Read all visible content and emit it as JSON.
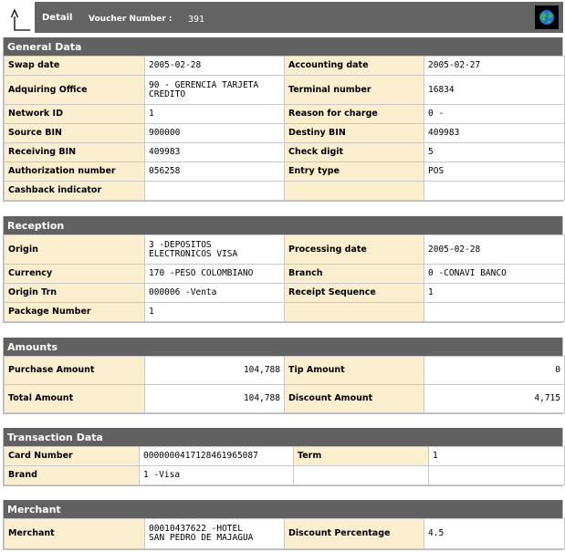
{
  "header": {
    "title": "Detail",
    "voucher_label": "Voucher Number :",
    "voucher_number": "391",
    "back_icon": "corner-up-left-arrow-icon",
    "globe_icon": "globe-icon"
  },
  "general": {
    "title": "General Data",
    "swap_date_label": "Swap date",
    "swap_date": "2005-02-28",
    "accounting_date_label": "Accounting date",
    "accounting_date": "2005-02-27",
    "acquiring_office_label": "Adquiring Office",
    "acquiring_office_1": "90 - GERENCIA TARJETA",
    "acquiring_office_2": "CREDITO",
    "terminal_number_label": "Terminal number",
    "terminal_number": "16834",
    "network_id_label": "Network ID",
    "network_id": "1",
    "reason_label": "Reason for charge",
    "reason": "0 -",
    "source_bin_label": "Source BIN",
    "source_bin": "900000",
    "destiny_bin_label": "Destiny BIN",
    "destiny_bin": "409983",
    "receiving_bin_label": "Receiving BIN",
    "receiving_bin": "409983",
    "check_digit_label": "Check digit",
    "check_digit": "5",
    "authorization_label": "Authorization number",
    "authorization": "056258",
    "entry_type_label": "Entry type",
    "entry_type": "POS",
    "cashback_label": "Cashback indicator",
    "cashback": ""
  },
  "reception": {
    "title": "Reception",
    "origin_label": "Origin",
    "origin_1": "3 -DEPOSITOS",
    "origin_2": "ELECTRONICOS VISA",
    "processing_date_label": "Processing date",
    "processing_date": "2005-02-28",
    "currency_label": "Currency",
    "currency": "170 -PESO COLOMBIANO",
    "branch_label": "Branch",
    "branch": "0 -CONAVI BANCO",
    "origin_trn_label": "Origin Trn",
    "origin_trn": "000006 -Venta",
    "receipt_sequence_label": "Receipt Sequence",
    "receipt_sequence": "1",
    "package_number_label": "Package Number",
    "package_number": "1"
  },
  "amounts": {
    "title": "Amounts",
    "purchase_label": "Purchase Amount",
    "purchase": "104,788",
    "tip_label": "Tip Amount",
    "tip": "0",
    "total_label": "Total Amount",
    "total": "104,788",
    "discount_label": "Discount Amount",
    "discount": "4,715"
  },
  "transaction": {
    "title": "Transaction Data",
    "card_number_label": "Card Number",
    "card_number": "0000000417128461965087",
    "term_label": "Term",
    "term": "1",
    "brand_label": "Brand",
    "brand": "1 -Visa"
  },
  "merchant": {
    "title": "Merchant",
    "merchant_label": "Merchant",
    "merchant_1": "00010437622 -HOTEL",
    "merchant_2": "SAN PEDRO DE MAJAGUA",
    "discount_pct_label": "Discount Percentage",
    "discount_pct": "4.5"
  }
}
